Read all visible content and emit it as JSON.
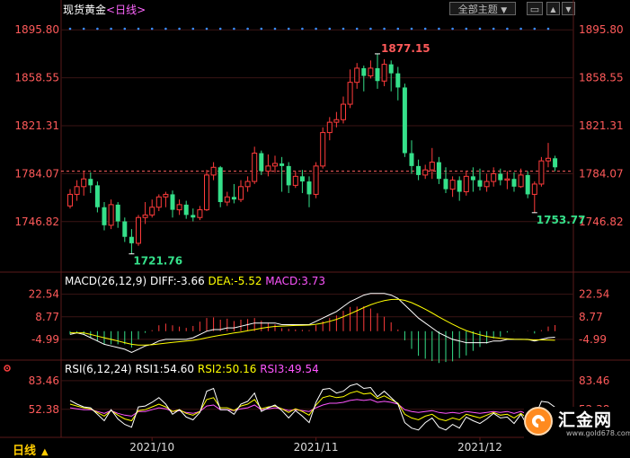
{
  "header": {
    "instrument": "现货黄金",
    "period": "<日线>",
    "theme_button": "全部主题",
    "theme_arrow": "▼",
    "btn_restore": "▭",
    "btn_up": "▲",
    "btn_down": "▼"
  },
  "footer": {
    "period_label": "日线",
    "period_arrow": "▲"
  },
  "logo": {
    "text": "汇金网",
    "url_text": "www.gold678.com"
  },
  "colors": {
    "up": "#ff3b3b",
    "down": "#35e08a",
    "axis_text": "#ff5a5a",
    "grid": "#3a1414",
    "dot_marker": "#3a8dff",
    "last_price_line": "#ff6060",
    "macd_diff": "#ffffff",
    "macd_dea": "#ffff00",
    "macd_bar_label": "#ff55ff",
    "rsi1": "#ffffff",
    "rsi2": "#ffff00",
    "rsi3": "#ff55ff"
  },
  "chart_data": [
    {
      "type": "candlestick",
      "title": "现货黄金<日线>",
      "ylim": [
        1709,
        1905
      ],
      "y_ticks": [
        1895.8,
        1858.55,
        1821.31,
        1784.07,
        1746.82
      ],
      "y_tick_labels": [
        "1895.80",
        "1858.55",
        "1821.31",
        "1784.07",
        "1746.82"
      ],
      "x_tick_labels": [
        "2021/10",
        "2021/11",
        "2021/12"
      ],
      "x_tick_index": [
        12,
        36,
        60
      ],
      "last_price": 1786,
      "annotations": [
        {
          "label": "1877.15",
          "index": 45,
          "value": 1877.15,
          "color": "#ff5a5a"
        },
        {
          "label": "1721.76",
          "index": 9,
          "value": 1721.76,
          "color": "#35e08a"
        },
        {
          "label": "1753.77",
          "index": 68,
          "value": 1753.77,
          "color": "#35e08a"
        }
      ],
      "candles": [
        [
          1759,
          1768,
          1757,
          1772
        ],
        [
          1768,
          1774,
          1763,
          1779
        ],
        [
          1774,
          1780,
          1767,
          1786
        ],
        [
          1780,
          1775,
          1769,
          1785
        ],
        [
          1775,
          1758,
          1754,
          1778
        ],
        [
          1758,
          1744,
          1740,
          1762
        ],
        [
          1744,
          1760,
          1741,
          1764
        ],
        [
          1760,
          1747,
          1742,
          1762
        ],
        [
          1747,
          1735,
          1731,
          1750
        ],
        [
          1735,
          1730,
          1721.76,
          1741
        ],
        [
          1730,
          1750,
          1728,
          1752
        ],
        [
          1750,
          1752,
          1745,
          1762
        ],
        [
          1752,
          1758,
          1750,
          1764
        ],
        [
          1758,
          1766,
          1755,
          1768
        ],
        [
          1766,
          1768,
          1758,
          1770
        ],
        [
          1768,
          1756,
          1750,
          1771
        ],
        [
          1756,
          1760,
          1752,
          1764
        ],
        [
          1760,
          1752,
          1749,
          1763
        ],
        [
          1752,
          1750,
          1747,
          1757
        ],
        [
          1750,
          1756,
          1748,
          1759
        ],
        [
          1756,
          1783,
          1755,
          1787
        ],
        [
          1783,
          1789,
          1779,
          1793
        ],
        [
          1789,
          1762,
          1758,
          1790
        ],
        [
          1762,
          1766,
          1759,
          1770
        ],
        [
          1766,
          1764,
          1761,
          1776
        ],
        [
          1764,
          1774,
          1762,
          1779
        ],
        [
          1774,
          1778,
          1770,
          1782
        ],
        [
          1778,
          1800,
          1776,
          1805
        ],
        [
          1800,
          1786,
          1783,
          1802
        ],
        [
          1786,
          1790,
          1782,
          1799
        ],
        [
          1790,
          1792,
          1785,
          1798
        ],
        [
          1792,
          1790,
          1770,
          1797
        ],
        [
          1790,
          1775,
          1769,
          1793
        ],
        [
          1775,
          1782,
          1773,
          1786
        ],
        [
          1782,
          1778,
          1769,
          1787
        ],
        [
          1778,
          1768,
          1758,
          1782
        ],
        [
          1768,
          1790,
          1765,
          1793
        ],
        [
          1790,
          1816,
          1788,
          1820
        ],
        [
          1816,
          1824,
          1810,
          1828
        ],
        [
          1824,
          1826,
          1820,
          1832
        ],
        [
          1826,
          1838,
          1823,
          1844
        ],
        [
          1838,
          1855,
          1835,
          1865
        ],
        [
          1855,
          1866,
          1850,
          1870
        ],
        [
          1866,
          1860,
          1848,
          1868
        ],
        [
          1860,
          1866,
          1858,
          1872
        ],
        [
          1866,
          1856,
          1850,
          1877.15
        ],
        [
          1856,
          1869,
          1852,
          1873
        ],
        [
          1869,
          1862,
          1848,
          1872
        ],
        [
          1862,
          1851,
          1841,
          1867
        ],
        [
          1851,
          1800,
          1797,
          1854
        ],
        [
          1800,
          1790,
          1784,
          1810
        ],
        [
          1790,
          1783,
          1779,
          1795
        ],
        [
          1783,
          1787,
          1780,
          1791
        ],
        [
          1787,
          1793,
          1780,
          1804
        ],
        [
          1793,
          1780,
          1776,
          1797
        ],
        [
          1780,
          1772,
          1769,
          1789
        ],
        [
          1772,
          1779,
          1766,
          1782
        ],
        [
          1779,
          1770,
          1763,
          1782
        ],
        [
          1770,
          1782,
          1767,
          1786
        ],
        [
          1782,
          1779,
          1770,
          1789
        ],
        [
          1779,
          1774,
          1771,
          1788
        ],
        [
          1774,
          1778,
          1770,
          1784
        ],
        [
          1778,
          1784,
          1774,
          1789
        ],
        [
          1784,
          1779,
          1775,
          1788
        ],
        [
          1779,
          1780,
          1772,
          1786
        ],
        [
          1780,
          1774,
          1770,
          1785
        ],
        [
          1774,
          1783,
          1773,
          1788
        ],
        [
          1783,
          1768,
          1765,
          1786
        ],
        [
          1768,
          1776,
          1753.77,
          1778
        ],
        [
          1776,
          1794,
          1774,
          1797
        ],
        [
          1794,
          1796,
          1789,
          1808
        ],
        [
          1796,
          1789,
          1786,
          1798
        ]
      ]
    },
    {
      "type": "bar",
      "title": "MACD(26,12,9)",
      "series_labels": [
        {
          "text": "DIFF:-3.66",
          "color": "#ffffff"
        },
        {
          "text": "DEA:-5.52",
          "color": "#ffff00"
        },
        {
          "text": "MACD:3.73",
          "color": "#ff55ff"
        }
      ],
      "ylim": [
        -16,
        30
      ],
      "y_ticks": [
        22.54,
        8.77,
        -4.99
      ],
      "y_tick_labels": [
        "22.54",
        "8.77",
        "-4.99"
      ],
      "diff": [
        -2,
        -1,
        -2,
        -4,
        -6,
        -8,
        -9,
        -10,
        -11,
        -13,
        -11,
        -9,
        -8,
        -6,
        -5,
        -5,
        -5,
        -5,
        -4,
        -2,
        0,
        1,
        1,
        2,
        2,
        3,
        4,
        5,
        5,
        5,
        5,
        4,
        4,
        4,
        4,
        4,
        6,
        8,
        10,
        12,
        15,
        18,
        20,
        22,
        23,
        23,
        23,
        22,
        20,
        16,
        12,
        8,
        5,
        2,
        -1,
        -3,
        -5,
        -6,
        -7,
        -7,
        -7,
        -7,
        -6,
        -6,
        -5,
        -5,
        -5,
        -5,
        -6,
        -5,
        -4,
        -3.66
      ],
      "dea": [
        -1,
        -1,
        -1,
        -2,
        -3,
        -4,
        -5,
        -6,
        -7,
        -8,
        -8.5,
        -8.5,
        -8.3,
        -7.8,
        -7.3,
        -6.8,
        -6.4,
        -6.0,
        -5.6,
        -4.9,
        -4.0,
        -3.2,
        -2.5,
        -1.8,
        -1.1,
        -0.5,
        0.3,
        1,
        1.8,
        2.4,
        2.9,
        3.1,
        3.3,
        3.5,
        3.6,
        3.7,
        4.2,
        5,
        6,
        7.2,
        8.8,
        10.6,
        12.5,
        14.4,
        16.1,
        17.5,
        18.6,
        19.3,
        19.5,
        18.8,
        17.4,
        15.5,
        13.4,
        11.1,
        8.7,
        6.4,
        4.2,
        2.2,
        0.4,
        -1,
        -2.2,
        -3.2,
        -3.8,
        -4.3,
        -4.6,
        -4.9,
        -5.0,
        -5.1,
        -5.3,
        -5.3,
        -5.4,
        -5.52
      ],
      "macd": [
        -2,
        -1,
        -2,
        -4,
        -6,
        -8,
        -8,
        -8,
        -8,
        -10,
        -5,
        -1,
        0.6,
        3.6,
        4.6,
        3.6,
        2.8,
        2.0,
        3.2,
        5.8,
        8,
        8.4,
        7,
        7.6,
        6.2,
        7,
        7.4,
        8,
        6.4,
        5.2,
        4.2,
        1.8,
        1.4,
        1,
        0.8,
        0.6,
        3.6,
        6,
        8,
        9.6,
        12.4,
        14.8,
        15,
        15.2,
        13.8,
        11,
        8.8,
        5.4,
        1,
        -5.6,
        -10.8,
        -15,
        -16.8,
        -18.2,
        -19.4,
        -18.8,
        -18.4,
        -16.4,
        -14.8,
        -12,
        -9.6,
        -7.6,
        -4.4,
        -3.4,
        -0.8,
        -0.2,
        0,
        0.2,
        -1.4,
        0.6,
        2.8,
        3.73
      ]
    },
    {
      "type": "line",
      "title": "RSI(6,12,24)",
      "series_labels": [
        {
          "text": "RSI1:54.60",
          "color": "#ffffff"
        },
        {
          "text": "RSI2:50.16",
          "color": "#ffff00"
        },
        {
          "text": "RSI3:49.54",
          "color": "#ff55ff"
        }
      ],
      "ylim": [
        22,
        95
      ],
      "y_ticks": [
        83.46,
        52.38
      ],
      "y_tick_labels": [
        "83.46",
        "52.38"
      ],
      "rsi1": [
        62,
        58,
        55,
        54,
        47,
        40,
        52,
        42,
        36,
        33,
        55,
        56,
        60,
        65,
        58,
        47,
        52,
        44,
        41,
        49,
        72,
        75,
        52,
        52,
        47,
        58,
        61,
        70,
        50,
        54,
        57,
        51,
        43,
        51,
        45,
        38,
        60,
        74,
        75,
        70,
        72,
        78,
        80,
        75,
        76,
        66,
        72,
        65,
        58,
        38,
        32,
        30,
        38,
        43,
        33,
        30,
        36,
        32,
        44,
        40,
        37,
        42,
        48,
        43,
        44,
        37,
        47,
        34,
        43,
        61,
        60,
        54.6
      ],
      "rsi2": [
        58,
        56,
        54,
        53,
        49,
        45,
        51,
        46,
        42,
        40,
        51,
        52,
        55,
        58,
        55,
        50,
        52,
        48,
        46,
        50,
        63,
        65,
        54,
        54,
        51,
        56,
        58,
        63,
        53,
        55,
        56,
        53,
        49,
        53,
        50,
        46,
        57,
        65,
        67,
        65,
        66,
        70,
        72,
        69,
        70,
        64,
        67,
        63,
        59,
        47,
        43,
        41,
        45,
        47,
        42,
        40,
        43,
        41,
        47,
        45,
        43,
        46,
        49,
        46,
        47,
        43,
        48,
        42,
        46,
        53,
        52,
        50.16
      ],
      "rsi3": [
        54,
        53,
        52,
        52,
        50,
        48,
        51,
        48,
        46,
        45,
        50,
        50,
        52,
        54,
        53,
        50,
        51,
        49,
        48,
        50,
        56,
        57,
        52,
        52,
        51,
        53,
        54,
        57,
        52,
        53,
        54,
        53,
        51,
        52,
        51,
        50,
        54,
        57,
        59,
        59,
        60,
        62,
        63,
        62,
        63,
        60,
        61,
        60,
        58,
        52,
        50,
        49,
        50,
        51,
        49,
        48,
        49,
        48,
        50,
        49,
        48,
        49,
        50,
        49,
        50,
        48,
        50,
        47,
        48,
        51,
        51,
        49.54
      ]
    }
  ]
}
